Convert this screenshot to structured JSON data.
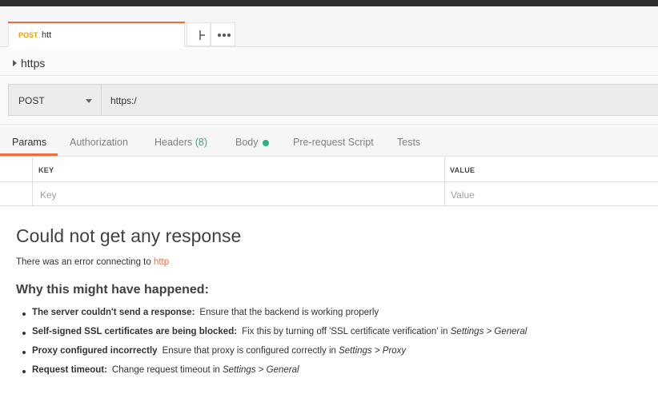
{
  "tab": {
    "method": "POST",
    "name": "htt"
  },
  "breadcrumb": {
    "text": "https"
  },
  "request": {
    "method": "POST",
    "url": "https:/"
  },
  "subtabs": [
    {
      "label": "Params"
    },
    {
      "label": "Authorization"
    },
    {
      "label": "Headers",
      "count": "(8)"
    },
    {
      "label": "Body"
    },
    {
      "label": "Pre-request Script"
    },
    {
      "label": "Tests"
    }
  ],
  "params": {
    "key_header": "KEY",
    "value_header": "VALUE",
    "key_placeholder": "Key",
    "value_placeholder": "Value"
  },
  "error": {
    "title": "Could not get any response",
    "message_prefix": "There was an error connecting to ",
    "message_url": "http",
    "why_heading": "Why this might have happened:",
    "reasons": [
      {
        "bold": "The server couldn't send a response:",
        "text": "Ensure that the backend is working properly"
      },
      {
        "bold": "Self-signed SSL certificates are being blocked:",
        "text": "Fix this by turning off 'SSL certificate verification' in ",
        "italic": "Settings > General"
      },
      {
        "bold": "Proxy configured incorrectly",
        "text": "Ensure that proxy is configured correctly in ",
        "italic": "Settings > Proxy"
      },
      {
        "bold": "Request timeout:",
        "text": "Change request timeout in ",
        "italic": "Settings > General"
      }
    ]
  },
  "colors": {
    "accent": "#f26b3a",
    "method_post": "#f0a000",
    "green": "#26b47f"
  }
}
